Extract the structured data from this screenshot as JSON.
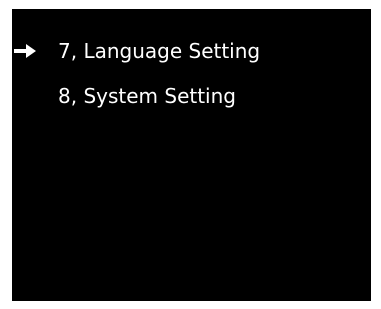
{
  "menu": {
    "items": [
      {
        "label": "7, Language Setting",
        "selected": true
      },
      {
        "label": "8, System Setting",
        "selected": false
      }
    ],
    "cursor_icon": "right-arrow-icon"
  },
  "colors": {
    "background": "#000000",
    "text": "#ffffff",
    "outer": "#ffffff"
  }
}
